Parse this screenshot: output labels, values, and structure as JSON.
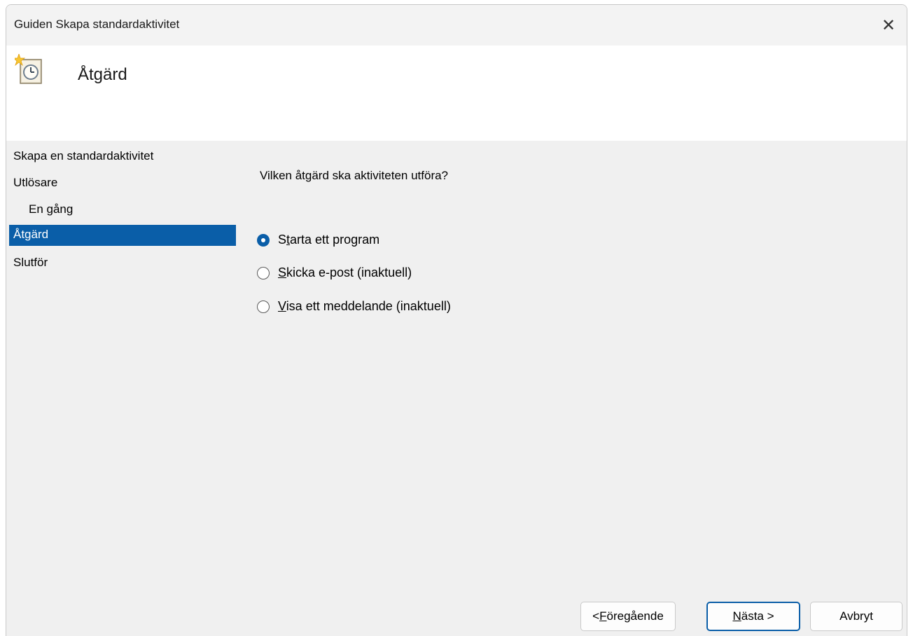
{
  "window": {
    "title": "Guiden Skapa standardaktivitet",
    "close_glyph": "✕",
    "close_icon": "close-icon"
  },
  "header": {
    "title": "Åtgärd",
    "icon": "task-scheduler-icon"
  },
  "nav": {
    "items": [
      {
        "label": "Skapa en standardaktivitet",
        "selected": false,
        "indent": false
      },
      {
        "label": "Utlösare",
        "selected": false,
        "indent": false
      },
      {
        "label": "En gång",
        "selected": false,
        "indent": true
      },
      {
        "label": "Åtgärd",
        "selected": true,
        "indent": false
      },
      {
        "label": "Slutför",
        "selected": false,
        "indent": false
      }
    ]
  },
  "main": {
    "question": "Vilken åtgärd ska aktiviteten utföra?",
    "options": [
      {
        "pre": "S",
        "accel": "t",
        "post": "arta ett program",
        "checked": true
      },
      {
        "pre": "",
        "accel": "S",
        "post": "kicka e-post (inaktuell)",
        "checked": false
      },
      {
        "pre": "",
        "accel": "V",
        "post": "isa ett meddelande (inaktuell)",
        "checked": false
      }
    ]
  },
  "buttons": {
    "back": {
      "pre": "< ",
      "accel": "F",
      "post": "öregående"
    },
    "next": {
      "pre": "",
      "accel": "N",
      "post": "ästa >"
    },
    "cancel": {
      "label": "Avbryt"
    }
  },
  "colors": {
    "accent": "#0a5ea8",
    "dialog_bg": "#f0f0f0",
    "header_bg": "#ffffff"
  }
}
